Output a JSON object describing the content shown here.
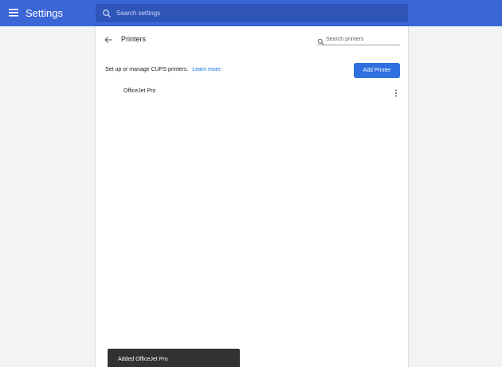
{
  "header": {
    "title": "Settings",
    "search_placeholder": "Search settings"
  },
  "page": {
    "title": "Printers",
    "search_placeholder": "Search printers",
    "description": "Set up or manage CUPS printers.",
    "learn_more": "Learn more",
    "add_button": "Add Printer",
    "printers": [
      {
        "name": "OfficeJet Pro"
      }
    ]
  },
  "toast": {
    "message": "Added OfficeJet Pro"
  },
  "colors": {
    "header_bg": "#3b66d6",
    "accent": "#1a73e8",
    "button_bg": "#2f6fe0",
    "toast_bg": "#323232"
  },
  "icons": {
    "menu": "menu-icon",
    "search": "search-icon",
    "back": "arrow-back-icon",
    "more": "more-vert-icon"
  }
}
